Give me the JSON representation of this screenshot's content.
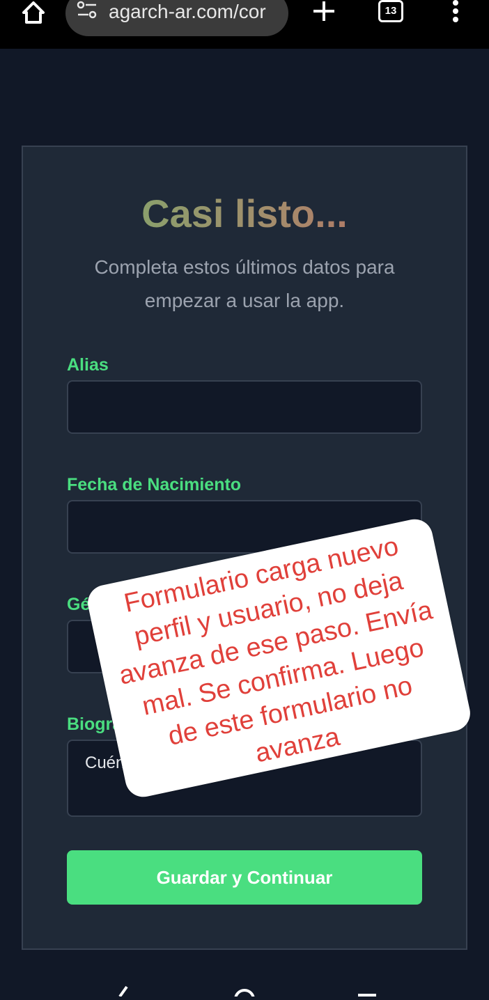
{
  "browser": {
    "url": "agarch-ar.com/cor",
    "tab_count": "13"
  },
  "card": {
    "title": "Casi listo...",
    "subtitle": "Completa estos últimos datos para empezar a usar la app.",
    "fields": [
      {
        "label": "Alias",
        "value": ""
      },
      {
        "label": "Fecha de Nacimiento",
        "value": ""
      },
      {
        "label": "Gén",
        "value": ""
      },
      {
        "label": "Biogra",
        "placeholder": "Cuéntan"
      }
    ],
    "submit_label": "Guardar y Continuar"
  },
  "annotation": {
    "lines": [
      "Formulario carga nuevo",
      "perfil y usuario, no deja",
      "avanza de ese paso. Envía",
      "mal. Se confirma. Luego",
      "de este formulario no",
      "avanza"
    ]
  },
  "colors": {
    "background": "#111827",
    "card": "#1f2937",
    "accent": "#4ade80",
    "annotation_text": "#e0403a"
  }
}
